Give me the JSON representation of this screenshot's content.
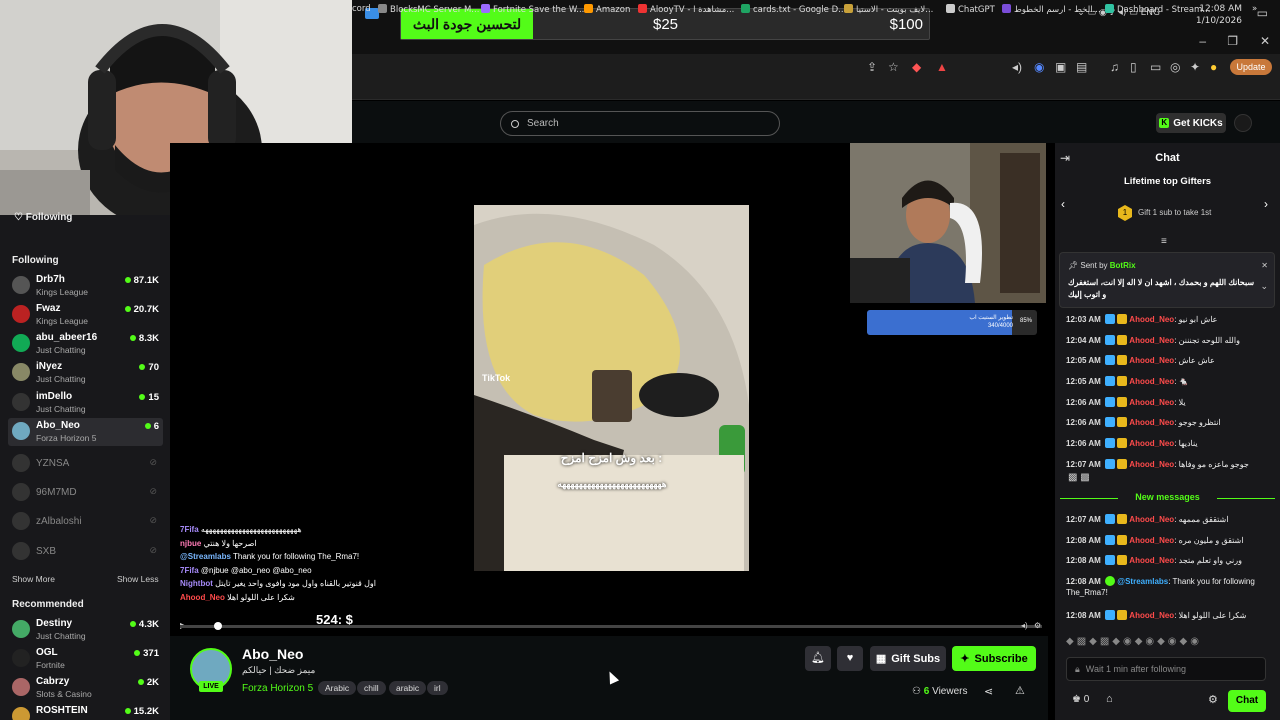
{
  "os": {
    "goal_label": "لتحسين جودة البث",
    "goal_mid": "$25",
    "goal_max": "$100",
    "tray_lang": "ENG",
    "time": "12:08 AM",
    "date": "1/10/2026"
  },
  "browser": {
    "update_label": "Update",
    "bookmarks": [
      {
        "label": "cord",
        "color": "#5865f2"
      },
      {
        "label": "BlocksMC Server M...",
        "color": "#888"
      },
      {
        "label": "Fortnite Save the W...",
        "color": "#9b6bff"
      },
      {
        "label": "Amazon",
        "color": "#ff9900"
      },
      {
        "label": "AlooyTV - مشاهدة ا...",
        "color": "#e33"
      },
      {
        "label": "cards.txt - Google D...",
        "color": "#1fa463"
      },
      {
        "label": "لايف بوينت - الاستيا...",
        "color": "#c8a13a"
      },
      {
        "label": "ChatGPT",
        "color": "#ccc"
      },
      {
        "label": "الخط - ارسم الخطوط...",
        "color": "#7a4dd8"
      },
      {
        "label": "Dashboard - Stream...",
        "color": "#31c3a2"
      }
    ]
  },
  "header": {
    "search_placeholder": "Search",
    "get_kicks": "Get KICKs"
  },
  "sidebar": {
    "following_top": "Following",
    "following_title": "Following",
    "channels": [
      {
        "name": "Drb7h",
        "game": "Kings League",
        "viewers": "87.1K",
        "color": "#555"
      },
      {
        "name": "Fwaz",
        "game": "Kings League",
        "viewers": "20.7K",
        "color": "#b22"
      },
      {
        "name": "abu_abeer16",
        "game": "Just Chatting",
        "viewers": "8.3K",
        "color": "#1a5"
      },
      {
        "name": "iNyez",
        "game": "Just Chatting",
        "viewers": "70",
        "color": "#886"
      },
      {
        "name": "imDello",
        "game": "Just Chatting",
        "viewers": "15",
        "color": "#333"
      },
      {
        "name": "Abo_Neo",
        "game": "Forza Horizon 5",
        "viewers": "6",
        "color": "#6fa9c0"
      }
    ],
    "offline": [
      "YZNSA",
      "96M7MD",
      "zAlbaloshi",
      "SXB"
    ],
    "show_more": "Show More",
    "show_less": "Show Less",
    "recommended_title": "Recommended",
    "recommended": [
      {
        "name": "Destiny",
        "game": "Just Chatting",
        "viewers": "4.3K"
      },
      {
        "name": "OGL",
        "game": "Fortnite",
        "viewers": "371"
      },
      {
        "name": "Cabrzy",
        "game": "Slots & Casino",
        "viewers": "2K"
      },
      {
        "name": "ROSHTEIN",
        "game": "",
        "viewers": "15.2K"
      }
    ]
  },
  "player": {
    "video_caption": "بعد وش امزح امزح :",
    "video_laugh": "هههههههههههههههههههههههههه",
    "tiktok": "TikTok",
    "cam2_bar_label": "تطوير الستيت اب",
    "cam2_bar_sub": "340/4000",
    "cam2_bar_pct": "85%",
    "cam2_bar_fraction": 0.85,
    "timer": "524: $",
    "overlay_chat": [
      {
        "user": "7Fifa",
        "text": "ههههههههههههههههههههههههههه",
        "color": "#a78bfa"
      },
      {
        "user": "njbue",
        "text": "اصرحها ولا هنتي",
        "color": "#ff7ab6"
      },
      {
        "user": "@Streamlabs",
        "text": "Thank you for following The_Rma7!",
        "color": "#7ab8ff"
      },
      {
        "user": "7Fifa",
        "text": "@njbue @abo_neo @abo_neo",
        "color": "#a78bfa"
      },
      {
        "user": "Nightbot",
        "text": "اول قنوتير بالقناه واول مود وافوى واحد يغير تايتل",
        "color": "#a78bfa"
      },
      {
        "user": "Ahood_Neo",
        "text": "شكرا على اللولو اهلا",
        "color": "#ff4b4b"
      }
    ]
  },
  "stream": {
    "name": "Abo_Neo",
    "title": "ميمز ضحك | حيالكم",
    "game": "Forza Horizon 5",
    "live": "LIVE",
    "tags": [
      "Arabic",
      "chill",
      "arabic",
      "irl"
    ],
    "gift_subs": "Gift Subs",
    "subscribe": "Subscribe",
    "viewers_count": "6",
    "viewers_label": "Viewers"
  },
  "chat": {
    "title": "Chat",
    "gifters_title": "Lifetime top Gifters",
    "gifters_rank": "1",
    "gifters_hint": "Gift 1 sub to take 1st",
    "pinned_by_label": "Sent by",
    "pinned_by_user": "BotRix",
    "pinned_msg": "سبحانك اللهم و بحمدك ، اشهد ان لا اله إلا انت، استغفرك و اتوب إليك",
    "messages": [
      {
        "time": "12:03 AM",
        "user": "Ahood_Neo",
        "text": "عاش ابو نيو"
      },
      {
        "time": "12:04 AM",
        "user": "Ahood_Neo",
        "text": "والله اللوحه تجنننن"
      },
      {
        "time": "12:05 AM",
        "user": "Ahood_Neo",
        "text": "عاش عاش"
      },
      {
        "time": "12:05 AM",
        "user": "Ahood_Neo",
        "text": "🐁"
      },
      {
        "time": "12:06 AM",
        "user": "Ahood_Neo",
        "text": "يلا"
      },
      {
        "time": "12:06 AM",
        "user": "Ahood_Neo",
        "text": "انتظرو جوجو"
      },
      {
        "time": "12:06 AM",
        "user": "Ahood_Neo",
        "text": "يناديها"
      },
      {
        "time": "12:07 AM",
        "user": "Ahood_Neo",
        "text": "جوجو ماعزه مو وفاها"
      }
    ],
    "new_messages": "New messages",
    "new": [
      {
        "time": "12:07 AM",
        "user": "Ahood_Neo",
        "text": "اشتققق مممهه",
        "kind": "user"
      },
      {
        "time": "12:08 AM",
        "user": "Ahood_Neo",
        "text": "اشتقق و مليون مره",
        "kind": "user"
      },
      {
        "time": "12:08 AM",
        "user": "Ahood_Neo",
        "text": "ورني واو تعلم متجد",
        "kind": "user"
      },
      {
        "time": "12:08 AM",
        "user": "@Streamlabs",
        "text": "Thank you for following The_Rma7!",
        "kind": "bot"
      },
      {
        "time": "12:08 AM",
        "user": "Ahood_Neo",
        "text": "شكرا على اللولو اهلا",
        "kind": "user"
      }
    ],
    "input_placeholder": "Wait 1 min after following",
    "kicks_count": "0",
    "chat_button": "Chat"
  }
}
